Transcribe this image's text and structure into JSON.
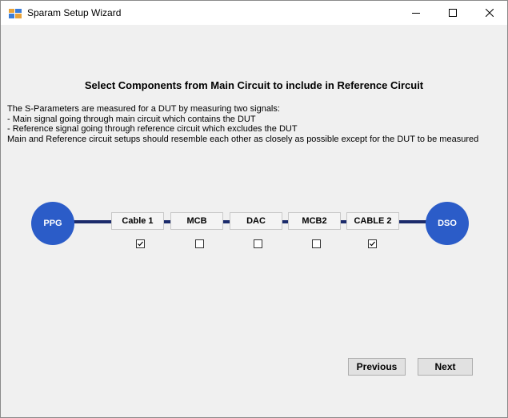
{
  "window": {
    "title": "Sparam Setup Wizard"
  },
  "heading": "Select Components from Main Circuit to include in Reference Circuit",
  "description": [
    "The S-Parameters are measured for a DUT by measuring two signals:",
    "- Main signal going through main circuit which contains the DUT",
    "- Reference signal going through reference circuit which excludes the DUT",
    "Main and Reference circuit setups should resemble each other as closely as possible except for the DUT to be measured"
  ],
  "circuit": {
    "source": "PPG",
    "sink": "DSO",
    "components": [
      {
        "label": "Cable 1",
        "checked": true
      },
      {
        "label": "MCB",
        "checked": false
      },
      {
        "label": "DAC",
        "checked": false
      },
      {
        "label": "MCB2",
        "checked": false
      },
      {
        "label": "CABLE 2",
        "checked": true
      }
    ]
  },
  "buttons": {
    "previous": "Previous",
    "next": "Next"
  },
  "colors": {
    "node": "#2b5cc8",
    "wire": "#1b2b6b"
  }
}
